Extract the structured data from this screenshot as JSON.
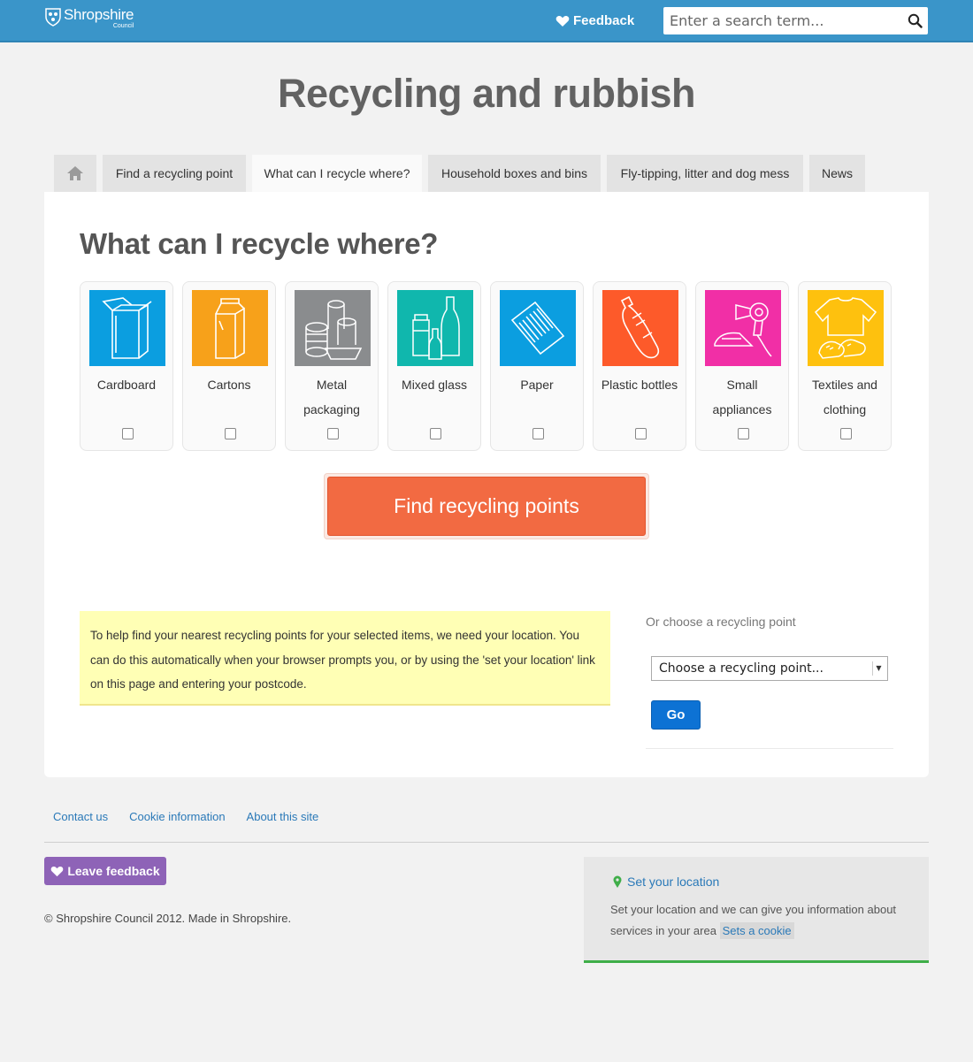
{
  "header": {
    "logo_main": "Shropshire",
    "logo_sub": "Council",
    "feedback_label": "Feedback",
    "search_placeholder": "Enter a search term...",
    "accent_color": "#3a95c9"
  },
  "page": {
    "title": "Recycling and rubbish"
  },
  "tabs": [
    {
      "label": "",
      "icon": "home-icon"
    },
    {
      "label": "Find a recycling point"
    },
    {
      "label": "What can I recycle where?",
      "active": true
    },
    {
      "label": "Household boxes and bins"
    },
    {
      "label": "Fly-tipping, litter and dog mess"
    },
    {
      "label": "News"
    }
  ],
  "main": {
    "title": "What can I recycle where?",
    "items": [
      {
        "label": "Cardboard",
        "color": "#0b9ee0",
        "icon": "cardboard-box-icon",
        "checked": false
      },
      {
        "label": "Cartons",
        "color": "#f7a11a",
        "icon": "carton-icon",
        "checked": false
      },
      {
        "label": "Metal packaging",
        "color": "#8a8c8e",
        "icon": "cans-icon",
        "checked": false
      },
      {
        "label": "Mixed glass",
        "color": "#10b7ad",
        "icon": "glass-bottles-icon",
        "checked": false
      },
      {
        "label": "Paper",
        "color": "#0b9ee0",
        "icon": "paper-icon",
        "checked": false
      },
      {
        "label": "Plastic bottles",
        "color": "#fd5a2a",
        "icon": "plastic-bottle-icon",
        "checked": false
      },
      {
        "label": "Small appliances",
        "color": "#f12fa6",
        "icon": "appliances-icon",
        "checked": false
      },
      {
        "label": "Textiles and clothing",
        "color": "#fec10e",
        "icon": "clothing-icon",
        "checked": false
      }
    ],
    "find_button": "Find recycling points",
    "notice": "To help find your nearest recycling points for your selected items, we need your location. You can do this automatically when your browser prompts you, or by using the 'set your location' link on this page and entering your postcode.",
    "choose_label": "Or choose a recycling point",
    "select_value": "Choose a recycling point...",
    "go_button": "Go"
  },
  "footer": {
    "links": [
      "Contact us",
      "Cookie information",
      "About this site"
    ],
    "leave_feedback": "Leave feedback",
    "copyright": "© Shropshire Council 2012. Made in Shropshire.",
    "location": {
      "title": "Set your location",
      "text": "Set your location and we can give you information about services in your area",
      "cookie_link": "Sets a cookie"
    }
  }
}
